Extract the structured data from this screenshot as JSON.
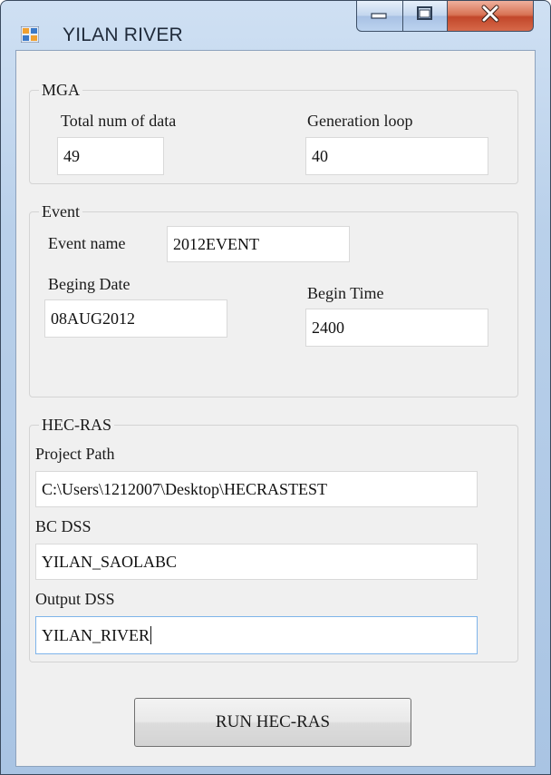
{
  "window": {
    "title": "YILAN RIVER",
    "icon": "windows-app-icon",
    "controls": [
      "minimize-icon",
      "maximize-icon",
      "close-icon"
    ]
  },
  "mga": {
    "legend": "MGA",
    "total_label": "Total num of data",
    "total_value": "49",
    "loop_label": "Generation loop",
    "loop_value": "40"
  },
  "event": {
    "legend": "Event",
    "name_label": "Event name",
    "name_value": "2012EVENT",
    "date_label": "Beging Date",
    "date_value": "08AUG2012",
    "time_label": "Begin Time",
    "time_value": "2400"
  },
  "hecras": {
    "legend": "HEC-RAS",
    "path_label": "Project Path",
    "path_value": "C:\\Users\\1212007\\Desktop\\HECRASTEST",
    "bc_label": "BC DSS",
    "bc_value": "YILAN_SAOLABC",
    "out_label": "Output DSS",
    "out_value": "YILAN_RIVER"
  },
  "run_button": "RUN HEC-RAS"
}
